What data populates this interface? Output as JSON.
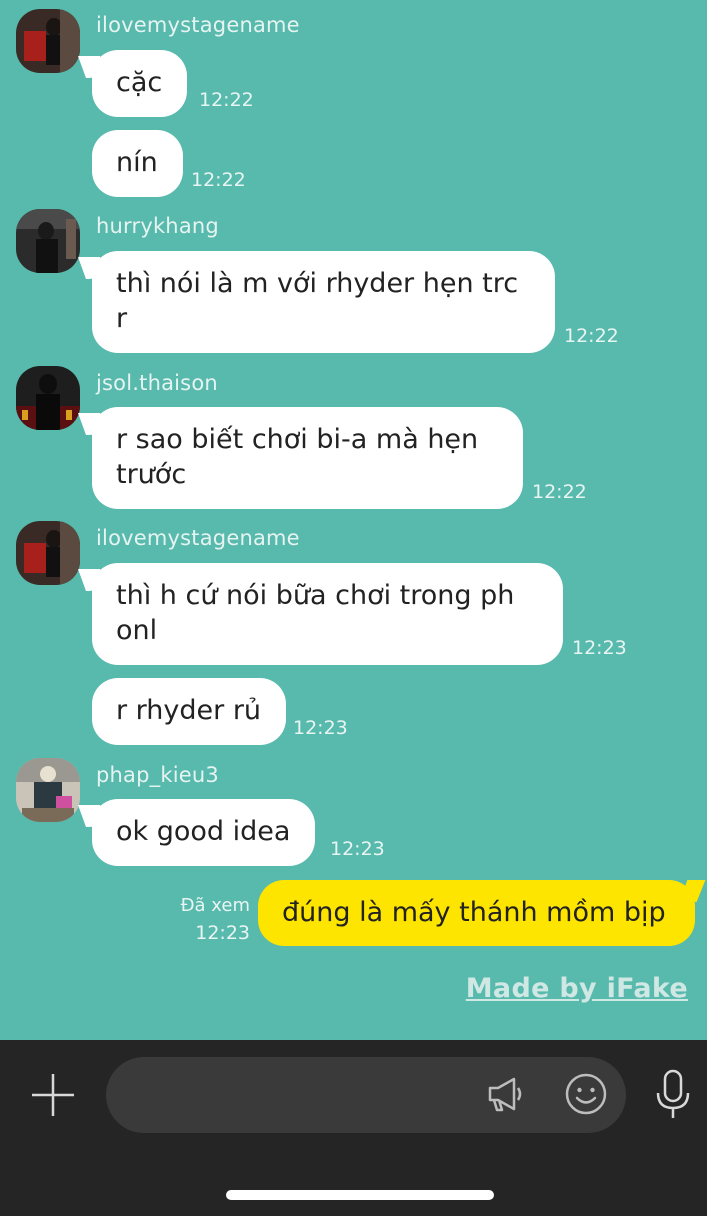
{
  "messages": [
    {
      "sender": "ilovemystagename",
      "text": "cặc",
      "time": "12:22"
    },
    {
      "text": "nín",
      "time": "12:22"
    },
    {
      "sender": "hurrykhang",
      "text": "thì nói là m với rhyder hẹn trc r",
      "time": "12:22"
    },
    {
      "sender": "jsol.thaison",
      "text": "r sao biết chơi bi-a mà hẹn trước",
      "time": "12:22"
    },
    {
      "sender": "ilovemystagename",
      "text": "thì h cứ nói bữa chơi trong ph onl",
      "time": "12:23"
    },
    {
      "text": "r rhyder rủ",
      "time": "12:23"
    },
    {
      "sender": "phap_kieu3",
      "text": "ok good idea",
      "time": "12:23"
    }
  ],
  "my_message": {
    "text": "đúng là mấy thánh mồm bịp",
    "status": "Đã xem",
    "time": "12:23"
  },
  "watermark": "Made by iFake",
  "colors": {
    "chat_bg": "#58b9ad",
    "my_bubble": "#fee500",
    "their_bubble": "#ffffff",
    "input_bar": "#252525"
  },
  "icons": [
    "plus-icon",
    "megaphone-icon",
    "emoji-icon",
    "microphone-icon"
  ]
}
